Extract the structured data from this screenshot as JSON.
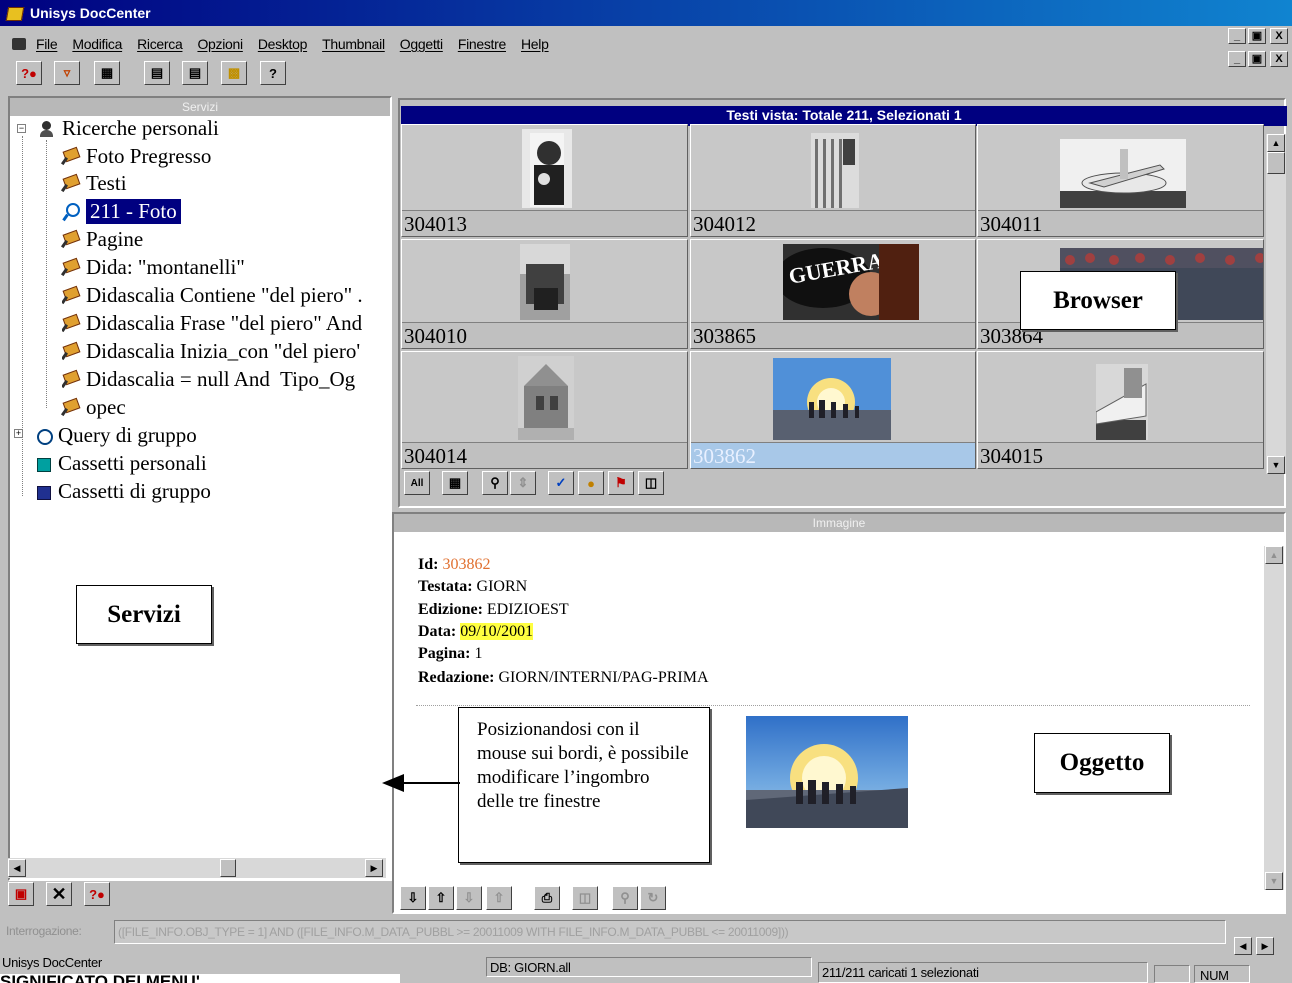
{
  "window": {
    "title": "Unisys DocCenter"
  },
  "menu": [
    "File",
    "Modifica",
    "Ricerca",
    "Opzioni",
    "Desktop",
    "Thumbnail",
    "Oggetti",
    "Finestre",
    "Help"
  ],
  "window_buttons": {
    "minimize": "_",
    "restore": "▣",
    "close": "X"
  },
  "toolbar_icons": [
    "new-query-icon",
    "filter-icon",
    "grid-view-icon",
    "trash-icon",
    "list-icon",
    "folder-icon",
    "help-icon"
  ],
  "services": {
    "header": "Servizi",
    "tree": [
      {
        "label": "Ricerche personali",
        "icon": "person-search-icon",
        "level": 0
      },
      {
        "label": "Foto Pregresso",
        "icon": "pushpin-icon",
        "level": 1
      },
      {
        "label": "Testi",
        "icon": "pushpin-icon",
        "level": 1
      },
      {
        "label": "211 - Foto",
        "icon": "magnifier-icon",
        "level": 1,
        "selected": true
      },
      {
        "label": "Pagine",
        "icon": "pushpin-icon",
        "level": 1
      },
      {
        "label": "Dida: \"montanelli\"",
        "icon": "pushpin-icon",
        "level": 1
      },
      {
        "label": "Didascalia Contiene \"del piero\" .",
        "icon": "pushpin-icon",
        "level": 1
      },
      {
        "label": "Didascalia Frase \"del piero\" And",
        "icon": "pushpin-icon",
        "level": 1
      },
      {
        "label": "Didascalia Inizia_con \"del piero'",
        "icon": "pushpin-icon",
        "level": 1
      },
      {
        "label": "Didascalia = null And  Tipo_Og",
        "icon": "pushpin-icon",
        "level": 1
      },
      {
        "label": "opec",
        "icon": "pushpin-icon",
        "level": 1
      },
      {
        "label": "Query di gruppo",
        "icon": "group-query-icon",
        "level": 0
      },
      {
        "label": "Cassetti personali",
        "icon": "drawer-icon",
        "level": 0
      },
      {
        "label": "Cassetti di gruppo",
        "icon": "group-drawer-icon",
        "level": 0
      }
    ],
    "callout": "Servizi",
    "bottom_icons": [
      "delete-icon",
      "close-icon",
      "new-query-icon"
    ]
  },
  "browser": {
    "header": "Testi vista: Totale 211, Selezionati 1",
    "callout": "Browser",
    "cells": [
      {
        "id": "304013",
        "thumb": "portrait-photo"
      },
      {
        "id": "304012",
        "thumb": "flag-photo"
      },
      {
        "id": "304011",
        "thumb": "airplane-photo"
      },
      {
        "id": "304010",
        "thumb": "street-photo"
      },
      {
        "id": "303865",
        "thumb": "guerra-photo",
        "overlay": "GUERRA"
      },
      {
        "id": "303864",
        "thumb": "crowd-photo"
      },
      {
        "id": "304014",
        "thumb": "building-photo"
      },
      {
        "id": "303862",
        "thumb": "landscape-photo",
        "selected": true
      },
      {
        "id": "304015",
        "thumb": "plane-tail-photo"
      }
    ],
    "tool_label_all": "All"
  },
  "detail": {
    "header": "Immagine",
    "fields": [
      {
        "label": "Id:",
        "value": "303862",
        "color": "#e07030"
      },
      {
        "label": "Testata:",
        "value": "GIORN"
      },
      {
        "label": "Edizione:",
        "value": "EDIZIOEST"
      },
      {
        "label": "Data:",
        "value": "09/10/2001",
        "highlight": "#ffff40"
      },
      {
        "label": "Pagina:",
        "value": "1"
      },
      {
        "label": "Redazione:",
        "value": "GIORN/INTERNI/PAG-PRIMA"
      }
    ],
    "note": "Posizionandosi con il mouse sui bordi, è possibile modificare l’ingombro delle tre finestre",
    "callout": "Oggetto"
  },
  "query_bar": {
    "label": "Interrogazione:",
    "value": "([FILE_INFO.OBJ_TYPE = 1] AND ([FILE_INFO.M_DATA_PUBBL >= 20011009 WITH FILE_INFO.M_DATA_PUBBL <= 20011009]))"
  },
  "statusbar": {
    "app": "Unisys DocCenter",
    "db": "DB: GIORN.all",
    "loaded": "211/211 caricati  1 selezionati",
    "num": "NUM"
  },
  "footer_text": "SIGNIFICATO DEI MENU'"
}
